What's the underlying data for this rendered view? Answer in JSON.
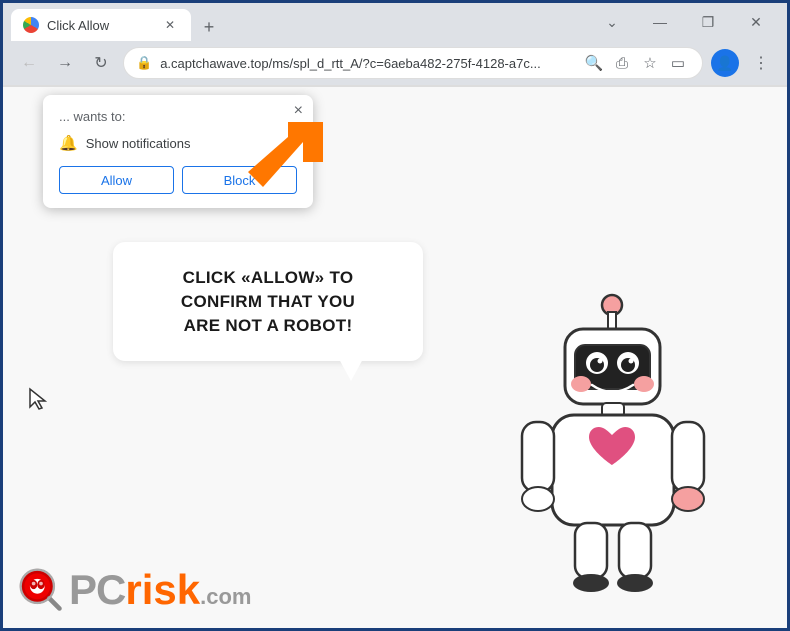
{
  "window": {
    "title": "Click Allow",
    "url": "a.captchawave.top/ms/spl_d_rtt_A/?c=6aeba482-275f-4128-a7c...",
    "url_full": "a.captchawave.top/ms/spl_d_rtt_A/?c=6aeba482-275f-4128-a7c..."
  },
  "controls": {
    "back": "←",
    "forward": "→",
    "refresh": "↻",
    "new_tab": "+",
    "minimize": "—",
    "maximize": "❐",
    "close": "✕",
    "tab_close": "✕",
    "menu_dots": "⋮"
  },
  "notification": {
    "wants_text": "... wants to:",
    "item_text": "Show notifications",
    "allow_label": "Allow",
    "block_label": "Block",
    "close_x": "×"
  },
  "page": {
    "bubble_line1": "CLICK «ALLOW» TO CONFIRM THAT YOU",
    "bubble_line2": "ARE NOT A ROBOT!"
  },
  "pcrisk": {
    "pc": "PC",
    "risk": "risk",
    "dotcom": ".com"
  },
  "icons": {
    "lock": "🔒",
    "search": "🔍",
    "share": "⎙",
    "star": "☆",
    "sidebar": "▭",
    "profile": "👤",
    "bell": "🔔"
  }
}
